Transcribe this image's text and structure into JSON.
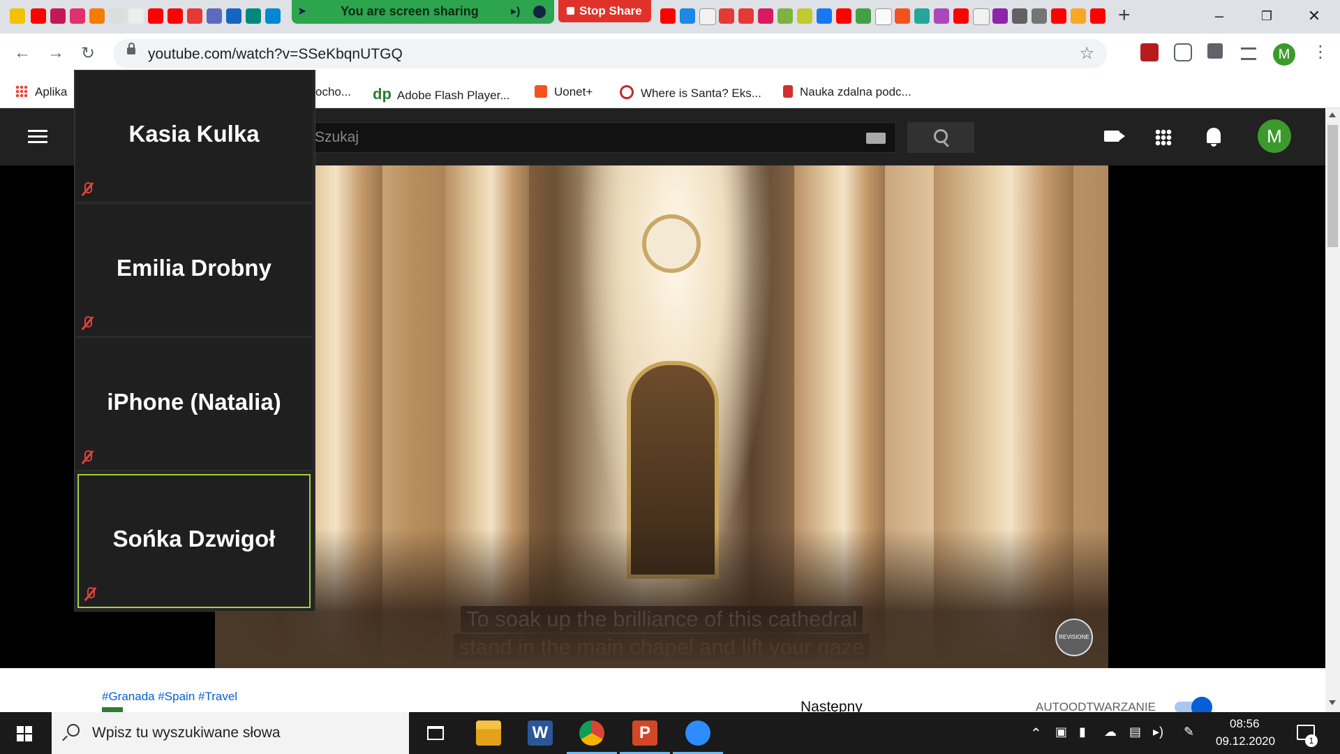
{
  "share_bar": {
    "status": "You are screen sharing",
    "stop_label": "Stop Share"
  },
  "browser": {
    "url": "youtube.com/watch?v=SSeKbqnUTGQ",
    "profile_initial": "M",
    "bookmarks": [
      {
        "label": "Aplika",
        "icon": "apps-grid-icon"
      },
      {
        "label": "ocho...",
        "icon": ""
      },
      {
        "label": "Adobe Flash Player...",
        "icon": "dp-icon"
      },
      {
        "label": "Uonet+",
        "icon": "uonet-icon"
      },
      {
        "label": "Where is Santa? Eks...",
        "icon": "santa-icon"
      },
      {
        "label": "Nauka zdalna podc...",
        "icon": "eagle-icon"
      }
    ]
  },
  "youtube": {
    "search_placeholder": "Szukaj",
    "avatar_initial": "M",
    "subtitle_lines": [
      "To soak up the brilliance of this cathedral",
      "stand in the main chapel and lift your gaze"
    ],
    "watermark": "REVISIONE",
    "hashtags": "#Granada #Spain #Travel",
    "next_label": "Następny",
    "autoplay_label": "AUTOODTWARZANIE",
    "autoplay_on": true
  },
  "zoom": {
    "participants": [
      {
        "name": "Kasia Kulka",
        "muted": true,
        "active": false
      },
      {
        "name": "Emilia Drobny",
        "muted": true,
        "active": false
      },
      {
        "name": "iPhone (Natalia)",
        "muted": true,
        "active": false
      },
      {
        "name": "Sońka Dzwigoł",
        "muted": true,
        "active": true
      }
    ]
  },
  "taskbar": {
    "search_placeholder": "Wpisz tu wyszukiwane słowa",
    "time": "08:56",
    "date": "09.12.2020",
    "notification_count": "1"
  },
  "colors": {
    "share_green": "#2da44e",
    "stop_red": "#e0322b",
    "active_speaker": "#9fd43c",
    "youtube_dark": "#212121",
    "link_blue": "#065fd4"
  }
}
